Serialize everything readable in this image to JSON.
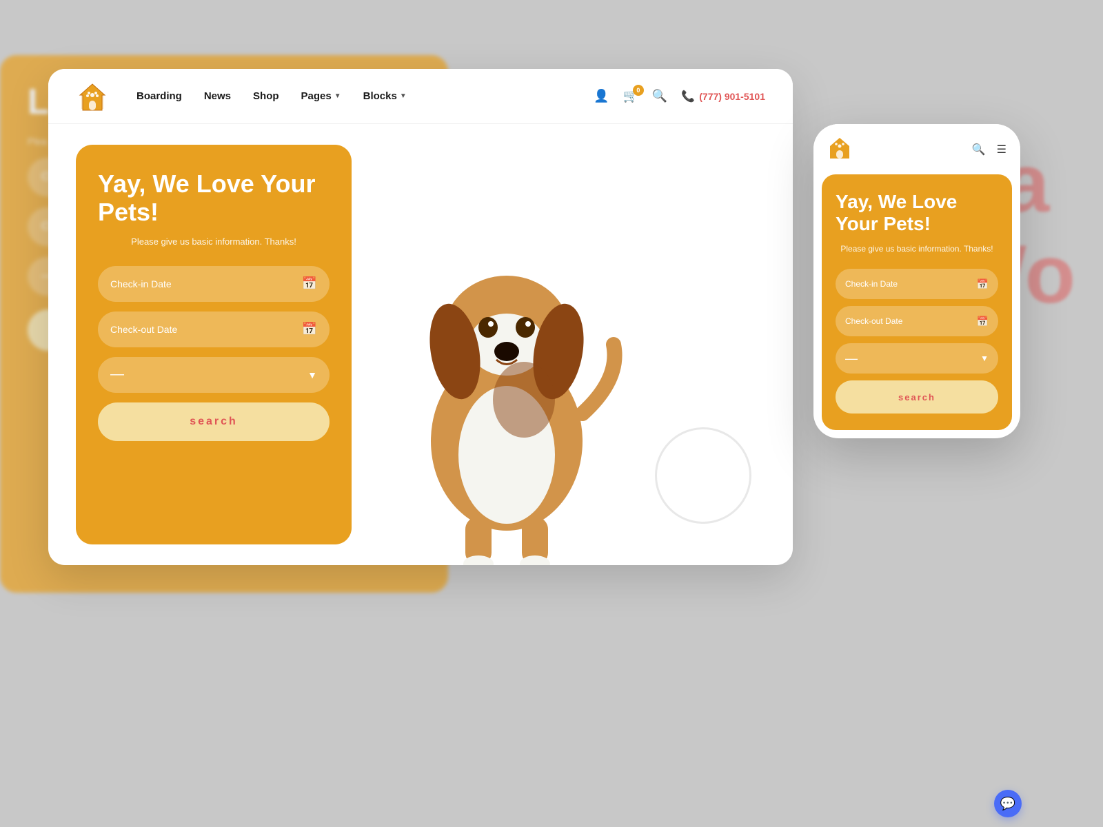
{
  "background": {
    "color": "#c8c8c8"
  },
  "desktop_card": {
    "navbar": {
      "logo_alt": "Pet House Logo",
      "links": [
        {
          "label": "Boarding",
          "has_dropdown": false
        },
        {
          "label": "News",
          "has_dropdown": false
        },
        {
          "label": "Shop",
          "has_dropdown": false
        },
        {
          "label": "Pages",
          "has_dropdown": true
        },
        {
          "label": "Blocks",
          "has_dropdown": true
        }
      ],
      "icons": {
        "user": "👤",
        "cart": "🛒",
        "cart_count": "0",
        "search": "🔍"
      },
      "phone": "(777) 901-5101"
    },
    "booking": {
      "title": "Yay, We Love Your Pets!",
      "subtitle": "Please give us basic information. Thanks!",
      "checkin_label": "Check-in Date",
      "checkout_label": "Check-out Date",
      "dropdown_placeholder": "—",
      "search_btn": "search"
    }
  },
  "mobile_card": {
    "booking": {
      "title": "Yay, We Love Your Pets!",
      "subtitle": "Please give us basic information. Thanks!",
      "checkin_label": "Check-in Date",
      "checkout_label": "Check-out Date",
      "dropdown_placeholder": "—",
      "search_btn": "search"
    }
  },
  "bg_text": {
    "left_title": "Lo",
    "right_text_line1": "Sa",
    "right_text_line2": "Wo"
  },
  "colors": {
    "primary_yellow": "#e8a020",
    "accent_red": "#e05555",
    "search_bg": "#f5dfa0",
    "chat_blue": "#4a6cf7"
  }
}
